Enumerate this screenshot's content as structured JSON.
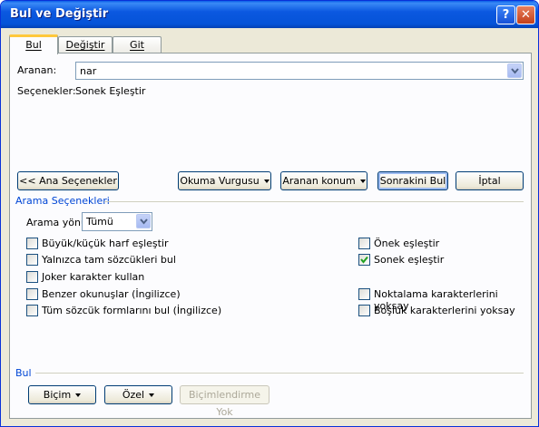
{
  "window": {
    "title": "Bul ve Değiştir",
    "help_glyph": "?",
    "close_glyph": "✕"
  },
  "tabs": [
    {
      "label": "Bul",
      "active": true
    },
    {
      "label": "Değiştir",
      "active": false
    },
    {
      "label": "Git",
      "active": false
    }
  ],
  "search": {
    "label": "Aranan:",
    "value": "nar"
  },
  "options_summary": {
    "label": "Seçenekler:",
    "value": "Sonek Eşleştir"
  },
  "buttons": {
    "less": "<< Ana Seçenekler",
    "reading_highlight": "Okuma Vurgusu",
    "find_in": "Aranan konum",
    "find_next": "Sonrakini Bul",
    "cancel": "İptal"
  },
  "search_options": {
    "group_title": "Arama Seçenekleri",
    "direction_label": "Arama yönü:",
    "direction_value": "Tümü",
    "checkboxes_left": [
      {
        "label": "Büyük/küçük harf eşleştir",
        "checked": false
      },
      {
        "label": "Yalnızca tam sözcükleri bul",
        "checked": false
      },
      {
        "label": "Joker karakter kullan",
        "checked": false
      },
      {
        "label": "Benzer okunuşlar (İngilizce)",
        "checked": false
      },
      {
        "label": "Tüm sözcük formlarını bul (İngilizce)",
        "checked": false
      }
    ],
    "checkboxes_right": [
      {
        "label": "Önek eşleştir",
        "checked": false
      },
      {
        "label": "Sonek eşleştir",
        "checked": true
      },
      {
        "label": "Noktalama karakterlerini yoksay",
        "checked": false
      },
      {
        "label": "Boşluk karakterlerini yoksay",
        "checked": false
      }
    ]
  },
  "find_group": {
    "title": "Bul",
    "format": "Biçim",
    "special": "Özel",
    "no_formatting": "Biçimlendirme Yok"
  }
}
